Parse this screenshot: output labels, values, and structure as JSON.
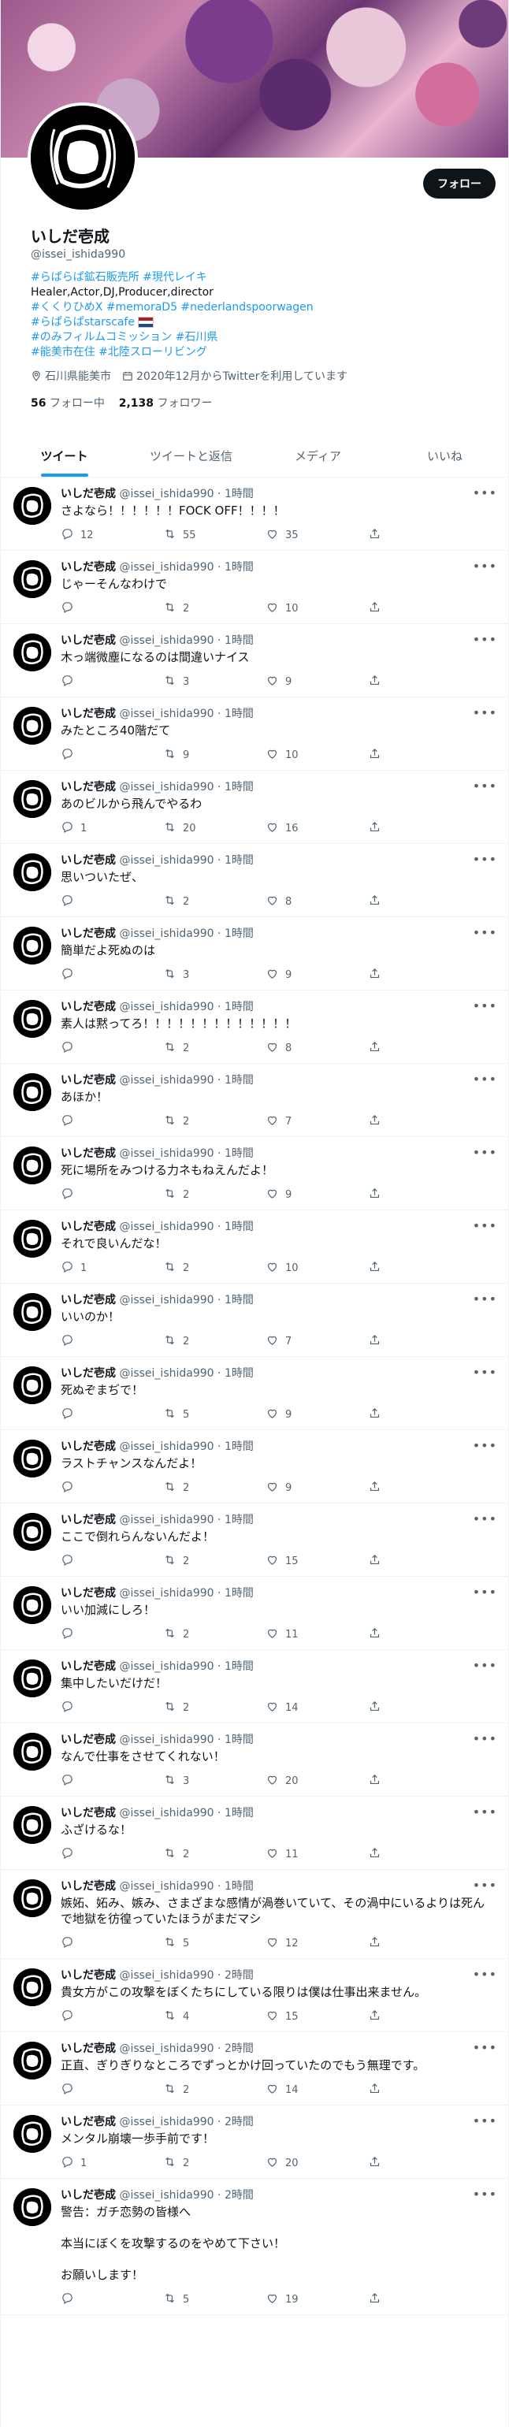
{
  "profile": {
    "name": "いしだ壱成",
    "handle": "@issei_ishida990",
    "follow_label": "フォロー",
    "bio_lines": [
      [
        "#らぱらぱ鉱石販売所 #現代レイキ"
      ],
      [
        "Healer,Actor,DJ,Producer,director"
      ],
      [
        "#くくりひめX #memoraD5 #nederlandspoorwagen"
      ],
      [
        "#らぱらぱstarscafe"
      ],
      [
        "#のみフィルムコミッション #石川県"
      ],
      [
        "#能美市在住 #北陸スローリビング"
      ]
    ],
    "location": "石川県能美市",
    "joined": "2020年12月からTwitterを利用しています",
    "following_count": "56",
    "following_label": "フォロー中",
    "followers_count": "2,138",
    "followers_label": "フォロワー"
  },
  "tabs": [
    "ツイート",
    "ツイートと返信",
    "メディア",
    "いいね"
  ],
  "tweets": [
    {
      "time": "1時間",
      "text": "さよなら！！！！！！FOCK OFF！！！！",
      "reply": "12",
      "rt": "55",
      "like": "35"
    },
    {
      "time": "1時間",
      "text": "じゃーそんなわけで",
      "reply": "",
      "rt": "2",
      "like": "10"
    },
    {
      "time": "1時間",
      "text": "木っ端微塵になるのは間違いナイス",
      "reply": "",
      "rt": "3",
      "like": "9"
    },
    {
      "time": "1時間",
      "text": "みたところ40階だて",
      "reply": "",
      "rt": "9",
      "like": "10"
    },
    {
      "time": "1時間",
      "text": "あのビルから飛んでやるわ",
      "reply": "1",
      "rt": "20",
      "like": "16"
    },
    {
      "time": "1時間",
      "text": "思いついたぜ、",
      "reply": "",
      "rt": "2",
      "like": "8"
    },
    {
      "time": "1時間",
      "text": "簡単だよ死ぬのは",
      "reply": "",
      "rt": "3",
      "like": "9"
    },
    {
      "time": "1時間",
      "text": "素人は黙ってろ！！！！！！！！！！！！！",
      "reply": "",
      "rt": "2",
      "like": "8"
    },
    {
      "time": "1時間",
      "text": "あほか！",
      "reply": "",
      "rt": "2",
      "like": "7"
    },
    {
      "time": "1時間",
      "text": "死に場所をみつける力ネもねえんだよ！",
      "reply": "",
      "rt": "2",
      "like": "9"
    },
    {
      "time": "1時間",
      "text": "それで良いんだな！",
      "reply": "1",
      "rt": "2",
      "like": "10"
    },
    {
      "time": "1時間",
      "text": "いいのか！",
      "reply": "",
      "rt": "2",
      "like": "7"
    },
    {
      "time": "1時間",
      "text": "死ぬぞまぢで！",
      "reply": "",
      "rt": "5",
      "like": "9"
    },
    {
      "time": "1時間",
      "text": "ラストチャンスなんだよ！",
      "reply": "",
      "rt": "2",
      "like": "9"
    },
    {
      "time": "1時間",
      "text": "ここで倒れらんないんだよ！",
      "reply": "",
      "rt": "2",
      "like": "15"
    },
    {
      "time": "1時間",
      "text": "いい加減にしろ！",
      "reply": "",
      "rt": "2",
      "like": "11"
    },
    {
      "time": "1時間",
      "text": "集中したいだけだ！",
      "reply": "",
      "rt": "2",
      "like": "14"
    },
    {
      "time": "1時間",
      "text": "なんで仕事をさせてくれない！",
      "reply": "",
      "rt": "3",
      "like": "20"
    },
    {
      "time": "1時間",
      "text": "ふざけるな！",
      "reply": "",
      "rt": "2",
      "like": "11"
    },
    {
      "time": "1時間",
      "text": "嫉妬、妬み、嫉み、さまざまな感情が渦巻いていて、その渦中にいるよりは死んで地獄を彷徨っていたほうがまだマシ",
      "reply": "",
      "rt": "5",
      "like": "12"
    },
    {
      "time": "2時間",
      "text": "貴女方がこの攻撃をぼくたちにしている限りは僕は仕事出来ません。",
      "reply": "",
      "rt": "4",
      "like": "15"
    },
    {
      "time": "2時間",
      "text": "正直、ぎりぎりなところでずっとかけ回っていたのでもう無理です。",
      "reply": "",
      "rt": "2",
      "like": "14"
    },
    {
      "time": "2時間",
      "text": "メンタル崩壊一歩手前です！",
      "reply": "1",
      "rt": "2",
      "like": "20"
    },
    {
      "time": "2時間",
      "text": "警告：ガチ恋勢の皆様へ\n\n本当にぼくを攻撃するのをやめて下さい！\n\nお願いします！",
      "reply": "",
      "rt": "5",
      "like": "19"
    }
  ]
}
